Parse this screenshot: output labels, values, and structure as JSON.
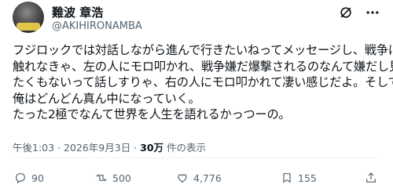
{
  "tweet": {
    "author_name": "難波 章浩",
    "author_handle": "@AKIHIRONAMBA",
    "text_lines": [
      "フジロックでは対話しながら進んで行きたいねってメッセージし、戦争に",
      "触れなきゃ、左の人にモロ叩かれ、戦争嫌だ爆撃されるのなんて嫌だし見",
      "たくもないって話しすりゃ、右の人にモロ叩かれて凄い感じだよ。そして",
      "俺はどんどん真ん中になっていく。",
      "たった2極でなんて世界を人生を語れるかっつーの。"
    ],
    "timestamp": "午後1:03 · 2026年9月3日 · ",
    "views_count": "30万",
    "views_label": " 件の表示"
  },
  "actions": {
    "replies": "90",
    "reposts": "500",
    "likes": "4,776",
    "bookmarks": "155"
  },
  "icons": {
    "grok": "grok-icon",
    "more": "more-icon",
    "reply": "reply-icon",
    "repost": "repost-icon",
    "like": "heart-icon",
    "bookmark": "bookmark-icon",
    "share": "share-icon"
  },
  "colors": {
    "text": "#0f1419",
    "secondary": "#536471",
    "divider": "#eff3f4"
  }
}
